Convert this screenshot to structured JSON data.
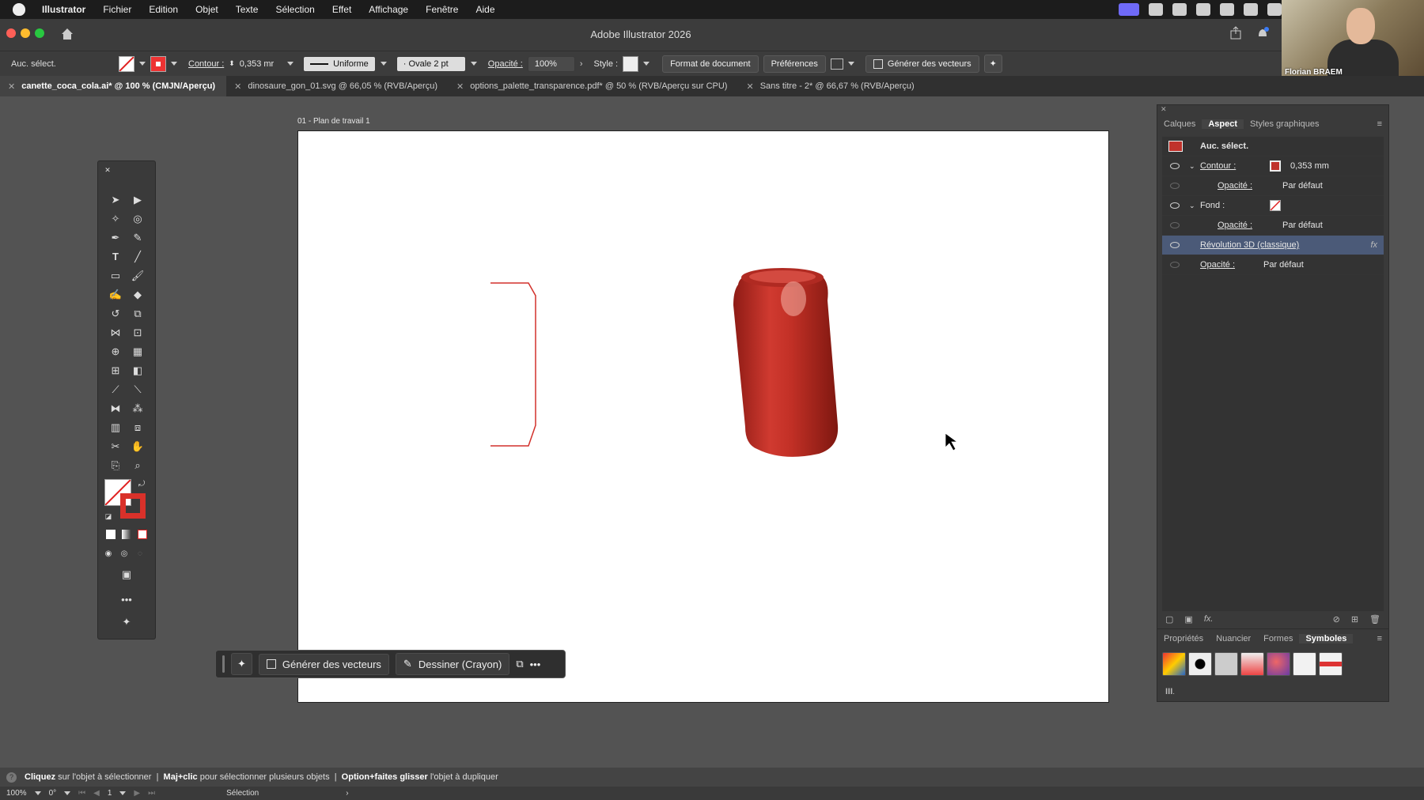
{
  "menubar": {
    "app": "Illustrator",
    "items": [
      "Fichier",
      "Edition",
      "Objet",
      "Texte",
      "Sélection",
      "Effet",
      "Affichage",
      "Fenêtre",
      "Aide"
    ]
  },
  "window": {
    "title": "Adobe Illustrator 2026"
  },
  "control": {
    "selection": "Auc. sélect.",
    "stroke_label": "Contour :",
    "stroke_value": "0,353 mr",
    "stroke_profile": "Uniforme",
    "brush": "Ovale 2 pt",
    "opacity_label": "Opacité :",
    "opacity_value": "100%",
    "style_label": "Style :",
    "doc_format": "Format de document",
    "prefs": "Préférences",
    "gen_vectors": "Générer des vecteurs"
  },
  "tabs": [
    {
      "label": "canette_coca_cola.ai* @ 100 % (CMJN/Aperçu)"
    },
    {
      "label": "dinosaure_gon_01.svg @ 66,05 % (RVB/Aperçu)"
    },
    {
      "label": "options_palette_transparence.pdf* @ 50 % (RVB/Aperçu sur CPU)"
    },
    {
      "label": "Sans titre - 2* @ 66,67 % (RVB/Aperçu)"
    }
  ],
  "webcam": {
    "name": "Florian BRAEM"
  },
  "artboard": {
    "label": "01 - Plan de travail 1"
  },
  "ctxbar": {
    "gen": "Générer des vecteurs",
    "draw": "Dessiner (Crayon)"
  },
  "panel": {
    "tabs": [
      "Calques",
      "Aspect",
      "Styles graphiques"
    ],
    "header": "Auc. sélect.",
    "rows": {
      "stroke_label": "Contour :",
      "stroke_value": "0,353 mm",
      "stroke_opacity_label": "Opacité :",
      "stroke_opacity_value": "Par défaut",
      "fill_label": "Fond :",
      "fill_opacity_label": "Opacité :",
      "fill_opacity_value": "Par défaut",
      "effect": "Révolution 3D (classique)",
      "opacity_label": "Opacité :",
      "opacity_value": "Par défaut"
    },
    "bottom_tabs": [
      "Propriétés",
      "Nuancier",
      "Formes",
      "Symboles"
    ]
  },
  "status": {
    "t1": "Cliquez",
    "t2": " sur l'objet à sélectionner  |  ",
    "t3": "Maj+clic",
    "t4": " pour sélectionner plusieurs objets  |  ",
    "t5": "Option+faites glisser",
    "t6": " l'objet à dupliquer"
  },
  "bottombar": {
    "zoom": "100%",
    "angle": "0°",
    "artboard_num": "1",
    "tool": "Sélection"
  },
  "colors": {
    "accent_red": "#c0322b",
    "selection_row": "#4b5a78"
  }
}
